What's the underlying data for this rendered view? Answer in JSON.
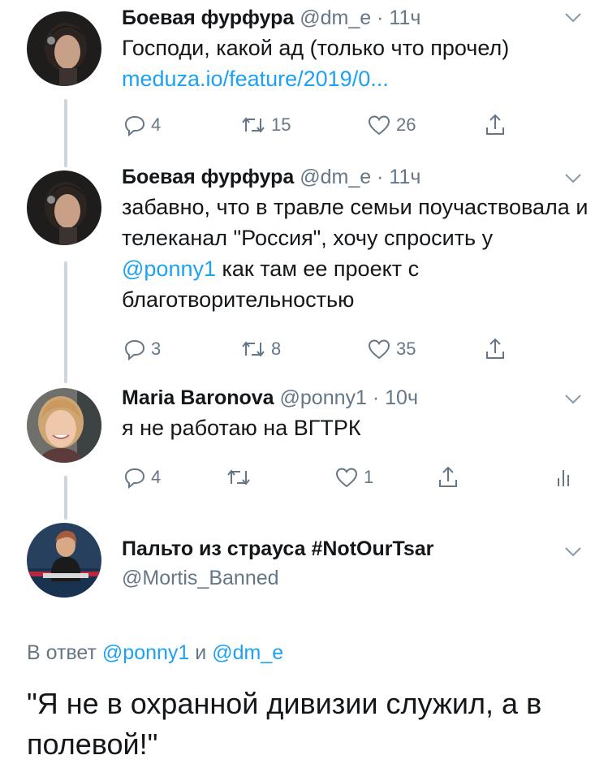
{
  "tweets": [
    {
      "author": "Боевая фурфура",
      "handle": "@dm_e",
      "separator": "·",
      "time": "11ч",
      "text_before": "Господи, какой ад (только что прочел) ",
      "link": "meduza.io/feature/2019/0...",
      "text_after": "",
      "replies": "4",
      "retweets": "15",
      "likes": "26"
    },
    {
      "author": "Боевая фурфура",
      "handle": "@dm_e",
      "separator": "·",
      "time": "11ч",
      "text_before": "забавно, что в травле семьи поучаствовала и телеканал \"Россия\", хочу спросить у ",
      "link": "@ponny1",
      "text_after": " как там ее проект с благотворительностью",
      "replies": "3",
      "retweets": "8",
      "likes": "35"
    },
    {
      "author": "Maria Baronova",
      "handle": "@ponny1",
      "separator": "·",
      "time": "10ч",
      "text": "я не работаю на ВГТРК",
      "replies": "4",
      "retweets": "",
      "likes": "1"
    }
  ],
  "focused_tweet": {
    "author": "Пальто из страуса #NotOurTsar",
    "handle": "@Mortis_Banned",
    "reply_prefix": "В ответ",
    "reply_to_1": "@ponny1",
    "reply_conjunction": "и",
    "reply_to_2": "@dm_e",
    "text": "\"Я не в охранной дивизии служил, а в полевой!\""
  },
  "icons": {
    "reply": "reply-icon",
    "retweet": "retweet-icon",
    "like": "heart-icon",
    "share": "share-icon",
    "analytics": "analytics-icon",
    "more": "chevron-down-icon"
  },
  "colors": {
    "link": "#1da1f2",
    "secondary_text": "#657786",
    "primary_text": "#14171a",
    "thread_line": "#ccd6dd"
  }
}
